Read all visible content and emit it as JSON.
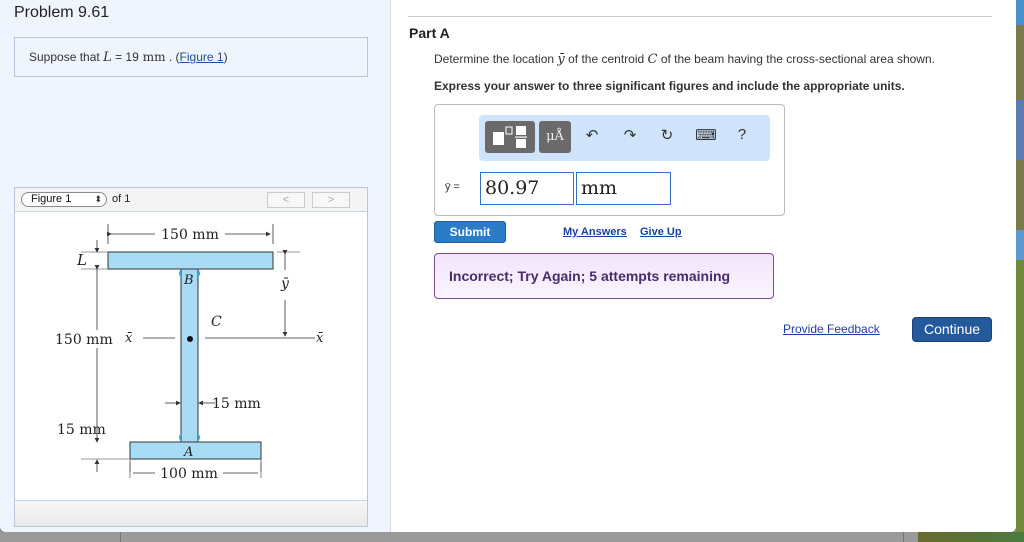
{
  "problem": {
    "title": "Problem 9.61",
    "statement_prefix": "Suppose that",
    "variable": "L",
    "equals_value": "= 19",
    "unit": "mm",
    "period": ". (",
    "figure_link": "Figure 1",
    "close_paren": ")"
  },
  "figure": {
    "selector_value": "Figure 1",
    "of_label": "of 1",
    "prev_label": "<",
    "next_label": ">",
    "labels": {
      "top_width": "150 mm",
      "flange_thickness": "L",
      "top_label": "B",
      "centroid_label": "C",
      "ybar": "ȳ",
      "xbar_left": "x̄",
      "xbar_right": "x̄",
      "height": "150 mm",
      "web_width": "15 mm",
      "bottom_thickness": "15 mm",
      "bottom_label": "A",
      "bottom_width": "100 mm"
    }
  },
  "part": {
    "title": "Part A",
    "question_prefix": "Determine the location",
    "question_var": "ȳ",
    "question_mid": "of the centroid",
    "question_var2": "C",
    "question_suffix": "of the beam having the cross-sectional area shown.",
    "instruction": "Express your answer to three significant figures and include the appropriate units."
  },
  "toolbar": {
    "units_label": "μÅ",
    "undo_icon": "↶",
    "redo_icon": "↷",
    "reset_icon": "↻",
    "keyboard_icon": "⌨",
    "help_label": "?"
  },
  "answer": {
    "label": "ȳ =",
    "value": "80.97",
    "unit": "mm"
  },
  "actions": {
    "submit": "Submit",
    "my_answers": "My Answers",
    "give_up": "Give Up",
    "feedback": "Incorrect; Try Again; 5 attempts remaining",
    "provide_feedback": "Provide Feedback",
    "continue": "Continue"
  }
}
